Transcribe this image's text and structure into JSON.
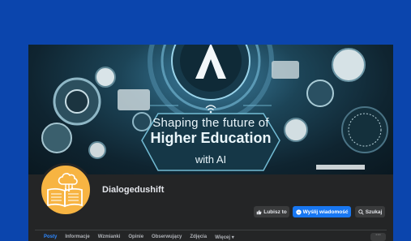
{
  "cover": {
    "line1": "Shaping the future of",
    "line2": "Higher Education",
    "line3": "with AI",
    "logo_letter": "A"
  },
  "profile": {
    "name": "Dialogedushift"
  },
  "actions": {
    "like_label": "Lubisz to",
    "message_label": "Wyślij wiadomość",
    "search_label": "Szukaj"
  },
  "tabs": [
    {
      "label": "Posty",
      "active": true
    },
    {
      "label": "Informacje",
      "active": false
    },
    {
      "label": "Wzmianki",
      "active": false
    },
    {
      "label": "Opinie",
      "active": false
    },
    {
      "label": "Obserwujący",
      "active": false
    },
    {
      "label": "Zdjęcia",
      "active": false
    },
    {
      "label": "Więcej ▾",
      "active": false
    }
  ],
  "more_label": "···",
  "colors": {
    "background": "#0b45ad",
    "page": "#242526",
    "primary_button": "#1877f2",
    "active_tab": "#2d88ff",
    "avatar": "#f7b442"
  },
  "icons": [
    "thumbs-up-icon",
    "messenger-icon",
    "search-icon",
    "book-cloud-icon"
  ]
}
